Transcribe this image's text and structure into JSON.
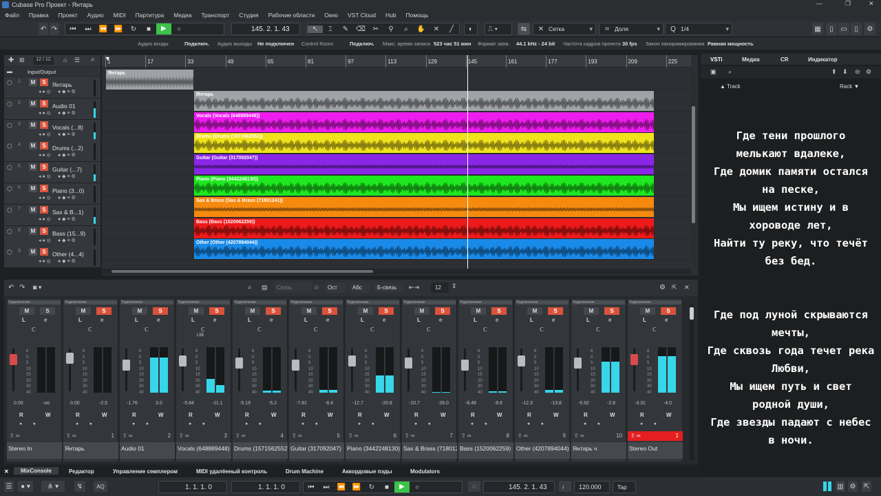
{
  "window": {
    "title": "Cubase Pro Проект - Янтарь",
    "controls": [
      "—",
      "❐",
      "✕"
    ]
  },
  "menu": [
    "Файл",
    "Правка",
    "Проект",
    "Аудио",
    "MIDI",
    "Партитура",
    "Медиа",
    "Транспорт",
    "Студия",
    "Рабочие области",
    "Окно",
    "VST Cloud",
    "Hub",
    "Помощь"
  ],
  "toolbar": {
    "position": "145. 2. 1. 43",
    "snap_label": "Сетка",
    "snap_type": "Доля",
    "quantize": "1/4"
  },
  "infobar": {
    "audio_in_label": "Аудио входы",
    "audio_in_val": "Подключ.",
    "audio_out_label": "Аудио выходы",
    "audio_out_val": "Не подключен",
    "control_room_label": "Control Room",
    "control_room_val": "Подключ.",
    "rec_time_label": "Макс. время записи",
    "rec_time_val": "523 час 51 мин",
    "format_label": "Формат запи.",
    "format_val": "44.1 kHz - 24 bit",
    "fps_label": "Частота кадров проекта",
    "fps_val": "30 fps",
    "pan_label": "Закон панорамирования",
    "pan_val": "Равная мощность"
  },
  "tracklist_header": {
    "count": "12 / 12",
    "folder": "Input/Output"
  },
  "tracks": [
    {
      "num": "1",
      "name": "Янтарь"
    },
    {
      "num": "2",
      "name": "Audio 01"
    },
    {
      "num": "3",
      "name": "Vocals (...8)"
    },
    {
      "num": "4",
      "name": "Drums (...2)"
    },
    {
      "num": "5",
      "name": "Guitar (...7)"
    },
    {
      "num": "6",
      "name": "Piano (3...0)"
    },
    {
      "num": "7",
      "name": "Sax & B...1)"
    },
    {
      "num": "8",
      "name": "Bass (15...9)"
    },
    {
      "num": "9",
      "name": "Other (4...4)"
    }
  ],
  "ruler": [
    "1",
    "17",
    "33",
    "49",
    "65",
    "81",
    "97",
    "113",
    "129",
    "145",
    "161",
    "177",
    "193",
    "209",
    "225"
  ],
  "clips": [
    {
      "label": "Янтарь",
      "color": "#a0a4a8"
    },
    {
      "label": "Янтарь",
      "color": "#a0a4a8"
    },
    {
      "label": "Vocals (Vocals (648889448))",
      "color": "#ee1cee"
    },
    {
      "label": "Drums (Drums (1571562552))",
      "color": "#f0e31c"
    },
    {
      "label": "Guitar (Guitar (317092047))",
      "color": "#8a26e6"
    },
    {
      "label": "Piano (Piano (3442248130))",
      "color": "#1ee81e"
    },
    {
      "label": "Sax & Brass (Sax & Brass (71801241))",
      "color": "#f58a0e"
    },
    {
      "label": "Bass (Bass (1520062259))",
      "color": "#ec1a1a"
    },
    {
      "label": "Other (Other (4207894044))",
      "color": "#1a8ae8"
    }
  ],
  "mixer_toolbar": {
    "link": "Связь",
    "ost": "Ост",
    "abs": "Абс",
    "blink": "Б-связь",
    "count": "12"
  },
  "mixer": [
    {
      "route": "Подключение",
      "name": "Stereo In",
      "num": "",
      "v1": "0.00",
      "v2": "-oo",
      "m": 0,
      "pan": "",
      "solo": false
    },
    {
      "route": "Подключение",
      "name": "Янтарь",
      "num": "1",
      "v1": "0.00",
      "v2": "-2.5",
      "m": 0,
      "pan": "",
      "solo": true
    },
    {
      "route": "Подключение",
      "name": "Audio 01",
      "num": "2",
      "v1": "-1.76",
      "v2": "3.0",
      "m": 0.78,
      "pan": "",
      "solo": true
    },
    {
      "route": "Подключение",
      "name": "Vocals (648889448)",
      "num": "3",
      "v1": "-5.84",
      "v2": "-11.1",
      "m": 0.3,
      "pan": "L55",
      "solo": true
    },
    {
      "route": "Подключение",
      "name": "Drums (1571562552)",
      "num": "4",
      "v1": "-5.19",
      "v2": "-5.2",
      "m": 0.05,
      "pan": "",
      "solo": true
    },
    {
      "route": "Подключение",
      "name": "Guitar (317092047)",
      "num": "5",
      "v1": "-7.81",
      "v2": "-8.4",
      "m": 0.06,
      "pan": "",
      "solo": true
    },
    {
      "route": "Подключение",
      "name": "Piano (3442248130)",
      "num": "6",
      "v1": "-12.7",
      "v2": "-20.8",
      "m": 0.38,
      "pan": "",
      "solo": true
    },
    {
      "route": "Подключение",
      "name": "Sax & Brass (71801241)",
      "num": "7",
      "v1": "-10.7",
      "v2": "-26.0",
      "m": 0.02,
      "pan": "",
      "solo": true
    },
    {
      "route": "Подключение",
      "name": "Bass (1520062259)",
      "num": "8",
      "v1": "-8.48",
      "v2": "-9.6",
      "m": 0.03,
      "pan": "",
      "solo": true
    },
    {
      "route": "Подключение",
      "name": "Other (4207894044)",
      "num": "9",
      "v1": "-12.3",
      "v2": "-13.8",
      "m": 0.06,
      "pan": "",
      "solo": true
    },
    {
      "route": "Подключение",
      "name": "Янтарь ч",
      "num": "10",
      "v1": "-5.92",
      "v2": "-2.8",
      "m": 0.68,
      "pan": "",
      "solo": true
    },
    {
      "route": "Подключение",
      "name": "Stereo Out",
      "num": "1",
      "v1": "-3.31",
      "v2": "-4.0",
      "m": 0.8,
      "pan": "",
      "solo": true
    }
  ],
  "bottom_tabs": [
    "MixConsole",
    "Редактор",
    "Управление семплером",
    "MIDI удалённый контроль",
    "Drum Machine",
    "Аккордовые пэды",
    "Modulators"
  ],
  "transport": {
    "left": "1. 1. 1. 0",
    "right": "1. 1. 1. 0",
    "pos": "145. 2. 1. 43",
    "tempo": "120.000",
    "tap": "Tap"
  },
  "right_zone": {
    "tabs": [
      "VSTi",
      "Медиа",
      "CR",
      "Индикатор"
    ],
    "track": "Track",
    "rack": "Rack"
  },
  "lyrics": [
    "Где тени прошлого",
    "мелькают вдалеке,",
    "Где домик памяти остался",
    "на песке,",
    "Мы ищем истину и в",
    "хороводе лет,",
    "Найти ту реку, что течёт",
    "без бед.",
    "",
    "",
    "Где под луной скрываются",
    "мечты,",
    "Где сквозь года течет река",
    "Любви,",
    "Мы ищем путь и свет",
    "родной души,",
    "Где звезды падают с небес",
    "в ночи."
  ]
}
